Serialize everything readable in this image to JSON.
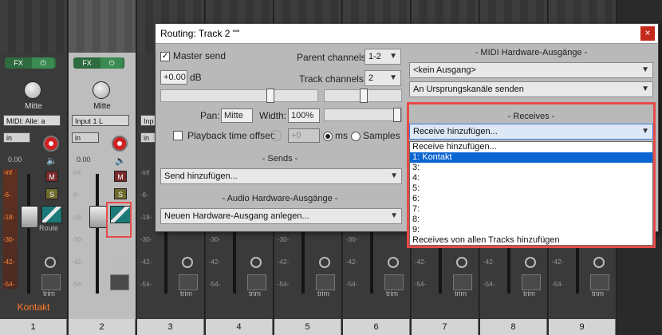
{
  "mixer": {
    "fx_label": "FX",
    "pan_label": "Mitte",
    "strips": [
      {
        "num": "1",
        "input": "MIDI: Alle: a",
        "name": "Kontakt",
        "in": "in",
        "vol": "0.00",
        "meter_active": true
      },
      {
        "num": "2",
        "input": "Input 1 L",
        "name": "",
        "in": "in",
        "vol": "0.00",
        "meter_active": false
      },
      {
        "num": "3",
        "input": "Inp",
        "name": "",
        "in": "in",
        "vol": "",
        "meter_active": false
      },
      {
        "num": "4",
        "input": "",
        "name": "",
        "in": "",
        "vol": "",
        "meter_active": false
      },
      {
        "num": "5",
        "input": "",
        "name": "",
        "in": "",
        "vol": "",
        "meter_active": false
      },
      {
        "num": "6",
        "input": "",
        "name": "",
        "in": "",
        "vol": "",
        "meter_active": false
      },
      {
        "num": "7",
        "input": "",
        "name": "",
        "in": "",
        "vol": "",
        "meter_active": false
      },
      {
        "num": "8",
        "input": "",
        "name": "",
        "in": "",
        "vol": "",
        "meter_active": false
      },
      {
        "num": "9",
        "input": "",
        "name": "",
        "in": "",
        "vol": "",
        "meter_active": false
      }
    ],
    "meter_ticks": [
      "-inf",
      "-6-",
      "-18-",
      "-30-",
      "-42-",
      "-54-"
    ],
    "meter_ticks_gray": [
      "-inf",
      "-6-",
      "-18-",
      "-30-",
      "-42-",
      "-54-"
    ],
    "mute_label": "M",
    "solo_label": "S",
    "route_label": "Route",
    "trim_label": "trim"
  },
  "dialog": {
    "title": "Routing: Track 2 \"\"",
    "close_glyph": "×",
    "master_send_label": "Master send",
    "master_send_checked": true,
    "parent_channels_label": "Parent channels:",
    "parent_channels_value": "1-2",
    "volume_value": "+0.00",
    "volume_unit": "dB",
    "track_channels_label": "Track channels:",
    "track_channels_value": "2",
    "pan_label": "Pan:",
    "pan_value": "Mitte",
    "width_label": "Width:",
    "width_value": "100%",
    "playback_offset_label": "Playback time offset:",
    "playback_offset_value": "+0",
    "ms_label": "ms",
    "samples_label": "Samples",
    "sends_header": "- Sends -",
    "sends_combo": "Send hinzufügen...",
    "audio_hw_header": "- Audio Hardware-Ausgänge -",
    "audio_hw_combo": "Neuen Hardware-Ausgang anlegen...",
    "midi_hw_header": "- MIDI Hardware-Ausgänge -",
    "midi_out_combo": "<kein Ausgang>",
    "midi_channels_combo": "An Ursprungskanäle senden",
    "receives_header": "- Receives -",
    "receives_combo": "Receive hinzufügen...",
    "receives_options": [
      "Receive hinzufügen...",
      "1: Kontakt",
      "3:",
      "4:",
      "5:",
      "6:",
      "7:",
      "8:",
      "9:",
      "Receives von allen Tracks hinzufügen"
    ],
    "receives_selected_index": 1
  },
  "colors": {
    "accent_highlight": "#e84a4a",
    "list_selection": "#0a64d2",
    "track_name": "#ff7a2a"
  }
}
